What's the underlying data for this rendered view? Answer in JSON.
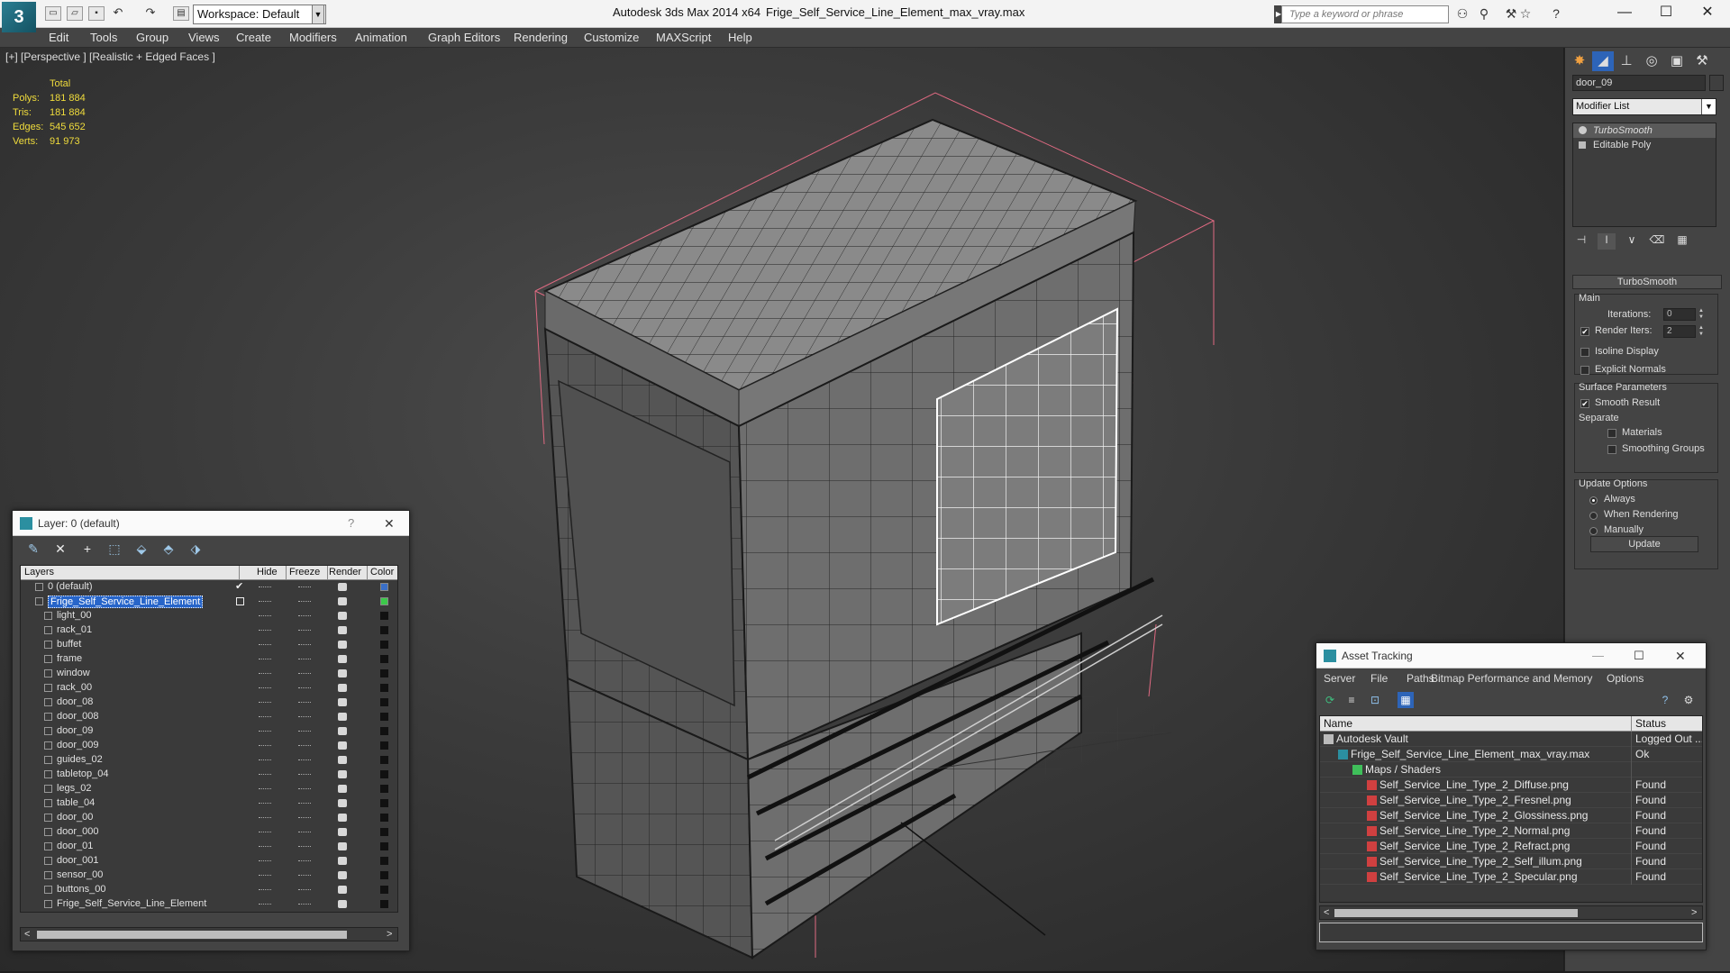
{
  "titlebar": {
    "workspace": "Workspace: Default",
    "app_title": "Autodesk 3ds Max  2014 x64",
    "file_title": "Frige_Self_Service_Line_Element_max_vray.max",
    "search_placeholder": "Type a keyword or phrase"
  },
  "menu": [
    "Edit",
    "Tools",
    "Group",
    "Views",
    "Create",
    "Modifiers",
    "Animation",
    "Graph Editors",
    "Rendering",
    "Customize",
    "MAXScript",
    "Help"
  ],
  "viewport": {
    "label": "[+] [Perspective ] [Realistic + Edged Faces ]",
    "stats": {
      "header": "Total",
      "rows": [
        {
          "label": "Polys:",
          "value": "181 884"
        },
        {
          "label": "Tris:",
          "value": "181 884"
        },
        {
          "label": "Edges:",
          "value": "545 652"
        },
        {
          "label": "Verts:",
          "value": "91 973"
        }
      ]
    }
  },
  "layer_panel": {
    "title": "Layer: 0 (default)",
    "help": "?",
    "close": "✕",
    "columns": [
      "Layers",
      "Hide",
      "Freeze",
      "Render",
      "Color"
    ],
    "layers": [
      {
        "name": "0 (default)",
        "level": 0,
        "color": "#3a6fc8"
      },
      {
        "name": "Frige_Self_Service_Line_Element",
        "level": 0,
        "selected": true,
        "color": "#3cc84a"
      },
      {
        "name": "light_00",
        "level": 1
      },
      {
        "name": "rack_01",
        "level": 1
      },
      {
        "name": "buffet",
        "level": 1
      },
      {
        "name": "frame",
        "level": 1
      },
      {
        "name": "window",
        "level": 1
      },
      {
        "name": "rack_00",
        "level": 1
      },
      {
        "name": "door_08",
        "level": 1
      },
      {
        "name": "door_008",
        "level": 1
      },
      {
        "name": "door_09",
        "level": 1
      },
      {
        "name": "door_009",
        "level": 1
      },
      {
        "name": "guides_02",
        "level": 1
      },
      {
        "name": "tabletop_04",
        "level": 1
      },
      {
        "name": "legs_02",
        "level": 1
      },
      {
        "name": "table_04",
        "level": 1
      },
      {
        "name": "door_00",
        "level": 1
      },
      {
        "name": "door_000",
        "level": 1
      },
      {
        "name": "door_01",
        "level": 1
      },
      {
        "name": "door_001",
        "level": 1
      },
      {
        "name": "sensor_00",
        "level": 1
      },
      {
        "name": "buttons_00",
        "level": 1
      },
      {
        "name": "Frige_Self_Service_Line_Element",
        "level": 1
      }
    ]
  },
  "command_panel": {
    "object_name": "door_09",
    "modifier_list": "Modifier List",
    "stack": [
      "TurboSmooth",
      "Editable Poly"
    ],
    "rollout_title": "TurboSmooth",
    "main_label": "Main",
    "iterations_label": "Iterations:",
    "iterations_value": "0",
    "render_iters_label": "Render Iters:",
    "render_iters_value": "2",
    "isoline_label": "Isoline Display",
    "explicit_normals_label": "Explicit Normals",
    "surface_params_label": "Surface Parameters",
    "smooth_result_label": "Smooth Result",
    "separate_label": "Separate",
    "materials_label": "Materials",
    "smoothing_groups_label": "Smoothing Groups",
    "update_options_label": "Update Options",
    "always_label": "Always",
    "when_rendering_label": "When Rendering",
    "manually_label": "Manually",
    "update_button": "Update"
  },
  "asset_panel": {
    "title": "Asset Tracking",
    "menu": [
      "Server",
      "File",
      "Paths",
      "Bitmap Performance and Memory",
      "Options"
    ],
    "columns": [
      "Name",
      "Status"
    ],
    "rows": [
      {
        "name": "Autodesk Vault",
        "status": "Logged Out ...",
        "level": 0,
        "icon": "vault"
      },
      {
        "name": "Frige_Self_Service_Line_Element_max_vray.max",
        "status": "Ok",
        "level": 1,
        "icon": "max"
      },
      {
        "name": "Maps / Shaders",
        "status": "",
        "level": 2,
        "icon": "maps"
      },
      {
        "name": "Self_Service_Line_Type_2_Diffuse.png",
        "status": "Found",
        "level": 3,
        "icon": "png"
      },
      {
        "name": "Self_Service_Line_Type_2_Fresnel.png",
        "status": "Found",
        "level": 3,
        "icon": "png"
      },
      {
        "name": "Self_Service_Line_Type_2_Glossiness.png",
        "status": "Found",
        "level": 3,
        "icon": "png"
      },
      {
        "name": "Self_Service_Line_Type_2_Normal.png",
        "status": "Found",
        "level": 3,
        "icon": "png"
      },
      {
        "name": "Self_Service_Line_Type_2_Refract.png",
        "status": "Found",
        "level": 3,
        "icon": "png"
      },
      {
        "name": "Self_Service_Line_Type_2_Self_illum.png",
        "status": "Found",
        "level": 3,
        "icon": "png"
      },
      {
        "name": "Self_Service_Line_Type_2_Specular.png",
        "status": "Found",
        "level": 3,
        "icon": "png"
      }
    ]
  }
}
